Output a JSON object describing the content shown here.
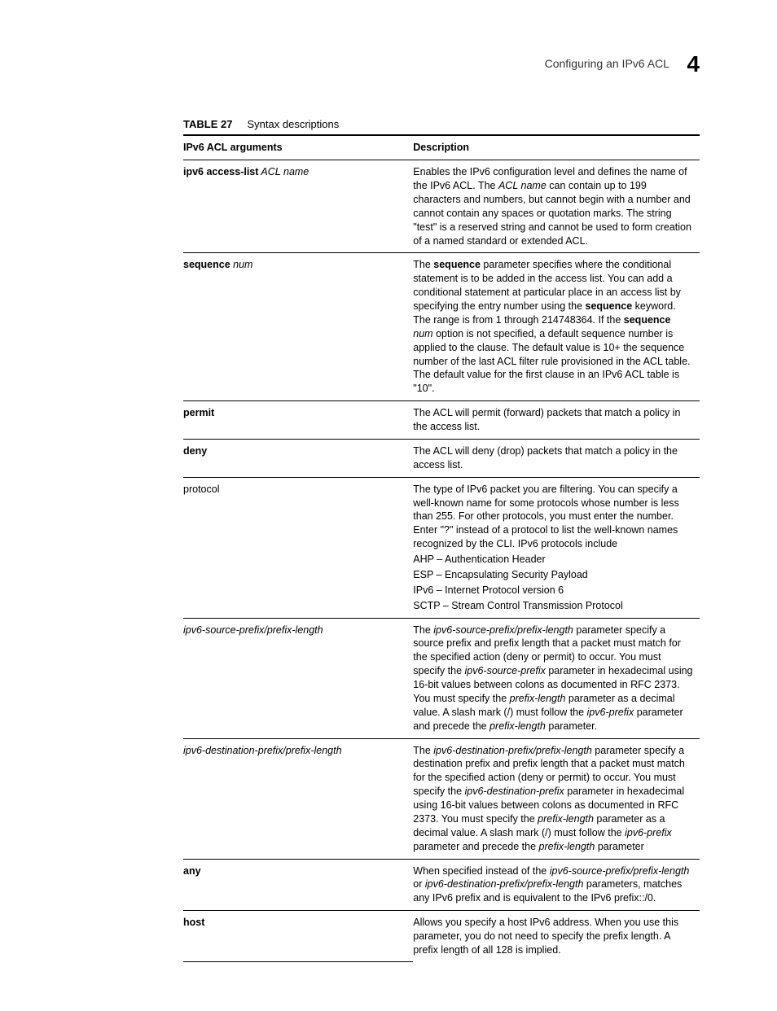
{
  "header": {
    "title": "Configuring an IPv6 ACL",
    "chapter": "4"
  },
  "caption": {
    "label": "TABLE 27",
    "text": "Syntax descriptions"
  },
  "columns": {
    "c1": "IPv6 ACL arguments",
    "c2": "Description"
  },
  "rows": {
    "r0": {
      "arg_b": "ipv6 access-list",
      "arg_i": " ACL name",
      "desc_a": "Enables the IPv6 configuration level and defines the name of the IPv6 ACL. The ",
      "desc_b": "ACL name",
      "desc_c": " can contain up to 199 characters and numbers, but cannot begin with a number and cannot contain any spaces or quotation marks. The string \"test\" is a reserved string and cannot be used to form creation of a named standard or extended ACL."
    },
    "r1": {
      "arg_b": "sequence",
      "arg_i": " num",
      "d1a": "The ",
      "d1b": "sequence",
      "d1c": " parameter specifies where the conditional statement is to be added in the access list. You can add a conditional statement at particular place in an access list by specifying the entry number using the ",
      "d1d": "sequence",
      "d1e": " keyword. The range is from 1 through 214748364. If the ",
      "d1f": "sequence",
      "d1g": " num",
      "d1h": " option is not specified, a default sequence number is applied to the clause. The default value is 10+ the sequence number of the last ACL filter rule provisioned in the ACL table. The default value for the first clause in an IPv6 ACL table is \"10\"."
    },
    "r2": {
      "arg_b": "permit",
      "desc": "The ACL will permit (forward) packets that match a policy in the access list."
    },
    "r3": {
      "arg_b": "deny",
      "desc": "The ACL will deny (drop) packets that match a policy in the access list."
    },
    "r4": {
      "arg": "protocol",
      "d1": "The type of IPv6 packet you are filtering. You can specify a well-known name for some protocols whose number is less than 255. For other protocols, you must enter the number. Enter \"?\" instead of a protocol to list the well-known names recognized by the CLI. IPv6 protocols include",
      "d2": "AHP – Authentication Header",
      "d3": "ESP – Encapsulating Security Payload",
      "d4": "IPv6 – Internet Protocol version 6",
      "d5": "SCTP – Stream Control Transmission Protocol"
    },
    "r5": {
      "arg_i": "ipv6-source-prefix/prefix-length",
      "a": "The ",
      "b": "ipv6-source-prefix/prefix-length",
      "c": " parameter specify a source prefix and prefix length that a packet must match for the specified action (deny or permit) to occur. You must specify the ",
      "d": "ipv6-source-prefix",
      "e": " parameter in hexadecimal using 16-bit values between colons as documented in RFC 2373. You must specify the ",
      "f": "prefix-length",
      "g": " parameter as a decimal value. A slash mark (/) must follow the ",
      "h": "ipv6-prefix",
      "i2": " parameter and precede the ",
      "j": "prefix-length",
      "k": " parameter."
    },
    "r6": {
      "arg_i": "ipv6-destination-prefix/prefix-length",
      "a": "The ",
      "b": "ipv6-destination-prefix/prefix-length",
      "c": " parameter specify a destination prefix and prefix length that a packet must match for the specified action (deny or permit) to occur. You must specify the ",
      "d": "ipv6-destination-prefix",
      "e": " parameter in hexadecimal using 16-bit values between colons as documented in RFC 2373. You must specify the ",
      "f": "prefix-length",
      "g": " parameter as a decimal value. A slash mark (/) must follow the ",
      "h": "ipv6-prefix",
      "i2": " parameter and precede the ",
      "j": "prefix-length",
      "k": " parameter"
    },
    "r7": {
      "arg_b": "any",
      "a": "When specified instead of the ",
      "b": "ipv6-source-prefix/prefix-length",
      "c": " or ",
      "d": "ipv6-destination-prefix/prefix-length",
      "e": " parameters, matches any IPv6 prefix and is equivalent to the IPv6 prefix::/0."
    },
    "r8": {
      "arg_b": "host",
      "desc": "Allows you specify a host IPv6 address. When you use this parameter, you do not need to specify the prefix length. A prefix length of all 128 is implied."
    }
  }
}
